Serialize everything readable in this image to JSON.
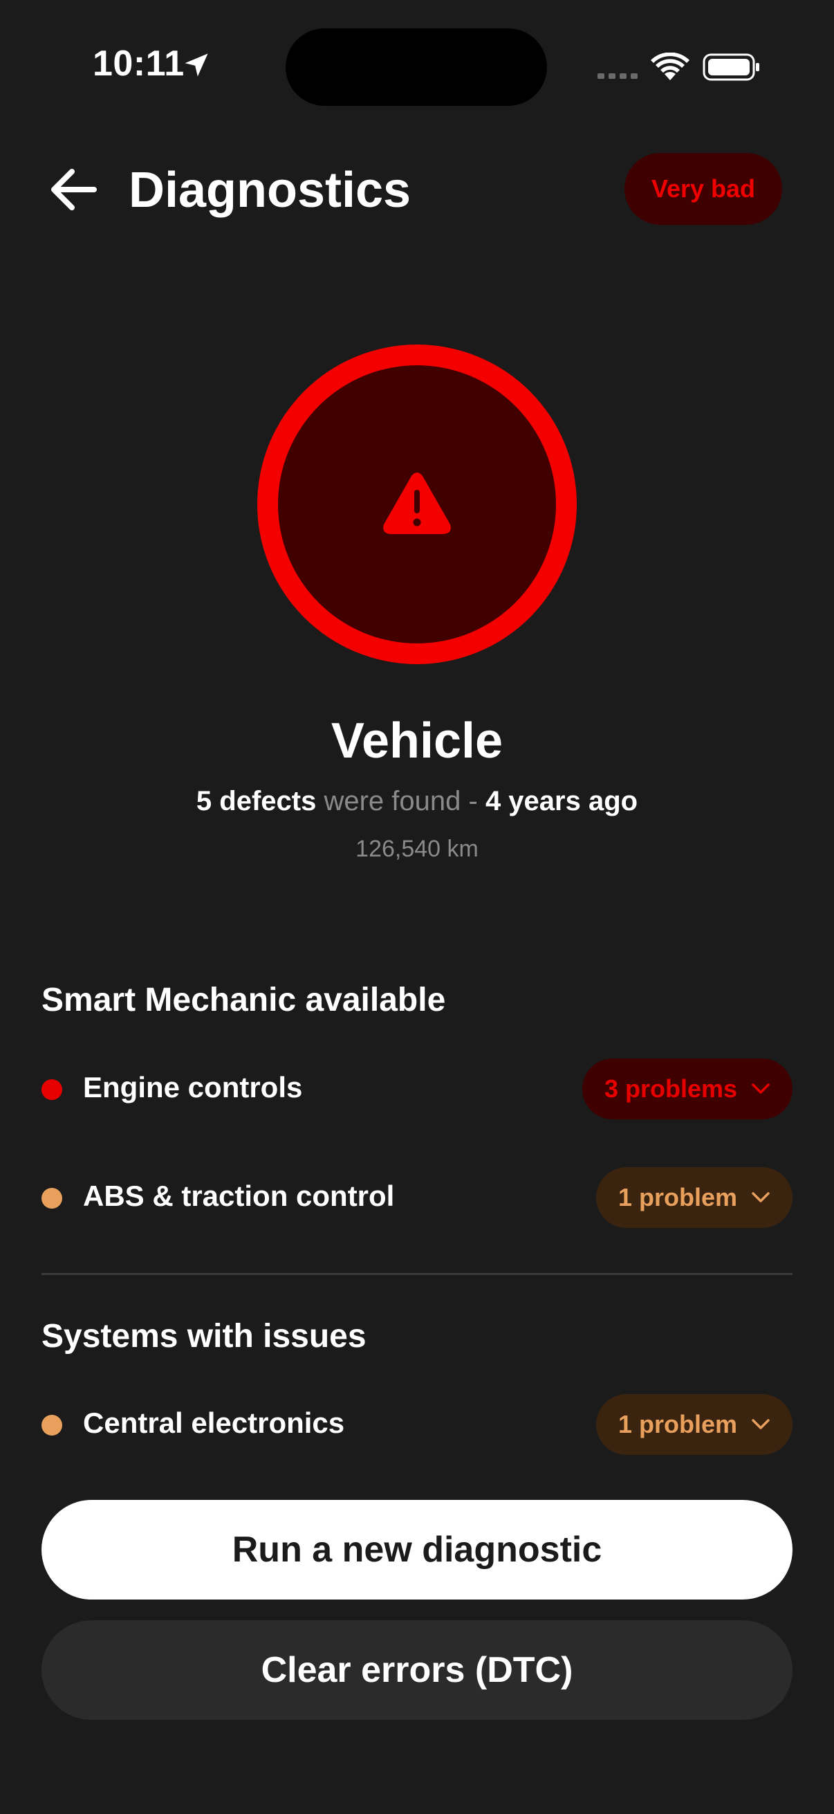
{
  "status_bar": {
    "time": "10:11"
  },
  "header": {
    "title": "Diagnostics",
    "badge": "Very bad"
  },
  "summary": {
    "title": "Vehicle",
    "defects_count": "5 defects",
    "defects_mid": "were found -",
    "defects_when": "4 years ago",
    "mileage": "126,540 km"
  },
  "sections": {
    "smart_mechanic": {
      "title": "Smart Mechanic available",
      "items": [
        {
          "label": "Engine controls",
          "pill": "3 problems",
          "severity": "red"
        },
        {
          "label": "ABS & traction control",
          "pill": "1 problem",
          "severity": "orange"
        }
      ]
    },
    "systems_issues": {
      "title": "Systems with issues",
      "items": [
        {
          "label": "Central electronics",
          "pill": "1 problem",
          "severity": "orange"
        }
      ]
    }
  },
  "actions": {
    "primary": "Run a new diagnostic",
    "secondary": "Clear errors (DTC)"
  },
  "colors": {
    "background": "#1b1b1b",
    "severity_red": "#e80000",
    "severity_orange": "#e9a05c",
    "warning_ring": "#f40000"
  },
  "icons": [
    "location-arrow-icon",
    "cellular-signal-icon",
    "wifi-icon",
    "battery-icon",
    "back-arrow-icon",
    "warning-triangle-icon",
    "chevron-down-icon"
  ]
}
